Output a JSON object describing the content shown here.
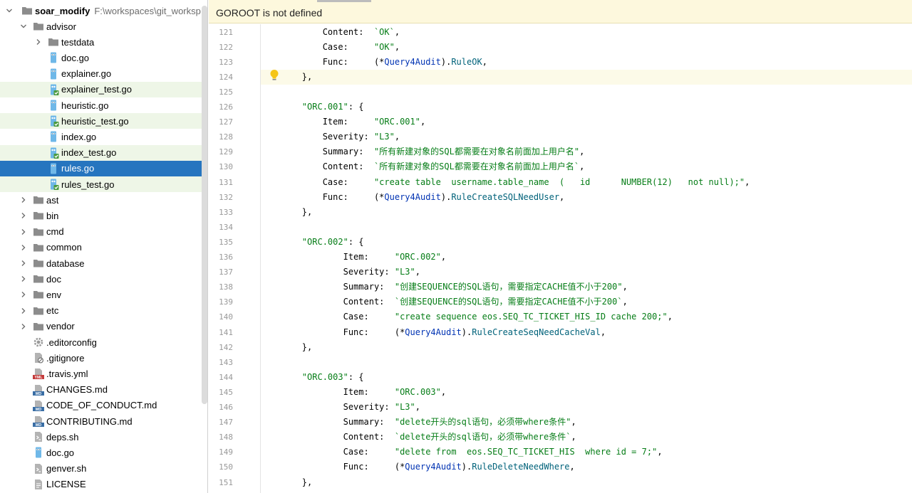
{
  "tree": {
    "root": {
      "name": "soar_modify",
      "path": "F:\\workspaces\\git_worksp"
    },
    "items": [
      {
        "label": "advisor",
        "type": "folder",
        "depth": 1,
        "expanded": true,
        "icon": "folder-icon"
      },
      {
        "label": "testdata",
        "type": "folder",
        "depth": 2,
        "expanded": false,
        "icon": "folder-icon"
      },
      {
        "label": "doc.go",
        "type": "file",
        "depth": 2,
        "icon": "go-file-icon"
      },
      {
        "label": "explainer.go",
        "type": "file",
        "depth": 2,
        "icon": "go-file-icon"
      },
      {
        "label": "explainer_test.go",
        "type": "file",
        "depth": 2,
        "icon": "go-test-file-icon",
        "tested": true
      },
      {
        "label": "heuristic.go",
        "type": "file",
        "depth": 2,
        "icon": "go-file-icon"
      },
      {
        "label": "heuristic_test.go",
        "type": "file",
        "depth": 2,
        "icon": "go-test-file-icon",
        "tested": true
      },
      {
        "label": "index.go",
        "type": "file",
        "depth": 2,
        "icon": "go-file-icon"
      },
      {
        "label": "index_test.go",
        "type": "file",
        "depth": 2,
        "icon": "go-test-file-icon",
        "tested": true
      },
      {
        "label": "rules.go",
        "type": "file",
        "depth": 2,
        "icon": "go-file-icon",
        "selected": true
      },
      {
        "label": "rules_test.go",
        "type": "file",
        "depth": 2,
        "icon": "go-test-file-icon",
        "tested": true
      },
      {
        "label": "ast",
        "type": "folder",
        "depth": 1,
        "expanded": false,
        "icon": "folder-icon"
      },
      {
        "label": "bin",
        "type": "folder",
        "depth": 1,
        "expanded": false,
        "icon": "folder-icon"
      },
      {
        "label": "cmd",
        "type": "folder",
        "depth": 1,
        "expanded": false,
        "icon": "folder-icon"
      },
      {
        "label": "common",
        "type": "folder",
        "depth": 1,
        "expanded": false,
        "icon": "folder-icon"
      },
      {
        "label": "database",
        "type": "folder",
        "depth": 1,
        "expanded": false,
        "icon": "folder-icon"
      },
      {
        "label": "doc",
        "type": "folder",
        "depth": 1,
        "expanded": false,
        "icon": "folder-icon"
      },
      {
        "label": "env",
        "type": "folder",
        "depth": 1,
        "expanded": false,
        "icon": "folder-icon"
      },
      {
        "label": "etc",
        "type": "folder",
        "depth": 1,
        "expanded": false,
        "icon": "folder-icon"
      },
      {
        "label": "vendor",
        "type": "folder",
        "depth": 1,
        "expanded": false,
        "icon": "folder-icon"
      },
      {
        "label": ".editorconfig",
        "type": "file",
        "depth": 1,
        "icon": "gear-icon"
      },
      {
        "label": ".gitignore",
        "type": "file",
        "depth": 1,
        "icon": "ignore-file-icon"
      },
      {
        "label": ".travis.yml",
        "type": "file",
        "depth": 1,
        "icon": "yaml-file-icon"
      },
      {
        "label": "CHANGES.md",
        "type": "file",
        "depth": 1,
        "icon": "markdown-file-icon"
      },
      {
        "label": "CODE_OF_CONDUCT.md",
        "type": "file",
        "depth": 1,
        "icon": "markdown-file-icon"
      },
      {
        "label": "CONTRIBUTING.md",
        "type": "file",
        "depth": 1,
        "icon": "markdown-file-icon"
      },
      {
        "label": "deps.sh",
        "type": "file",
        "depth": 1,
        "icon": "shell-file-icon"
      },
      {
        "label": "doc.go",
        "type": "file",
        "depth": 1,
        "icon": "go-file-icon"
      },
      {
        "label": "genver.sh",
        "type": "file",
        "depth": 1,
        "icon": "shell-file-icon"
      },
      {
        "label": "LICENSE",
        "type": "file",
        "depth": 1,
        "icon": "text-file-icon"
      }
    ]
  },
  "editor": {
    "notice": "GOROOT is not defined",
    "current_line": 124,
    "lines": [
      {
        "n": 121,
        "tokens": [
          [
            "p",
            "            Content:  "
          ],
          [
            "s",
            "`OK`"
          ],
          [
            "p",
            ","
          ]
        ]
      },
      {
        "n": 122,
        "tokens": [
          [
            "p",
            "            Case:     "
          ],
          [
            "s",
            "\"OK\""
          ],
          [
            "p",
            ","
          ]
        ]
      },
      {
        "n": 123,
        "tokens": [
          [
            "p",
            "            Func:     (*"
          ],
          [
            "t",
            "Query4Audit"
          ],
          [
            "p",
            ")."
          ],
          [
            "f",
            "RuleOK"
          ],
          [
            "p",
            ","
          ]
        ]
      },
      {
        "n": 124,
        "tokens": [
          [
            "p",
            "        },"
          ]
        ]
      },
      {
        "n": 125,
        "tokens": []
      },
      {
        "n": 126,
        "tokens": [
          [
            "p",
            "        "
          ],
          [
            "s",
            "\"ORC.001\""
          ],
          [
            "p",
            ": {"
          ]
        ]
      },
      {
        "n": 127,
        "tokens": [
          [
            "p",
            "            Item:     "
          ],
          [
            "s",
            "\"ORC.001\""
          ],
          [
            "p",
            ","
          ]
        ]
      },
      {
        "n": 128,
        "tokens": [
          [
            "p",
            "            Severity: "
          ],
          [
            "s",
            "\"L3\""
          ],
          [
            "p",
            ","
          ]
        ]
      },
      {
        "n": 129,
        "tokens": [
          [
            "p",
            "            Summary:  "
          ],
          [
            "s",
            "\"所有新建对象的SQL都需要在对象名前面加上用户名\""
          ],
          [
            "p",
            ","
          ]
        ]
      },
      {
        "n": 130,
        "tokens": [
          [
            "p",
            "            Content:  "
          ],
          [
            "s",
            "`所有新建对象的SQL都需要在对象名前面加上用户名`"
          ],
          [
            "p",
            ","
          ]
        ]
      },
      {
        "n": 131,
        "tokens": [
          [
            "p",
            "            Case:     "
          ],
          [
            "s",
            "\"create table  username.table_name  (   id      NUMBER(12)   not null);\""
          ],
          [
            "p",
            ","
          ]
        ]
      },
      {
        "n": 132,
        "tokens": [
          [
            "p",
            "            Func:     (*"
          ],
          [
            "t",
            "Query4Audit"
          ],
          [
            "p",
            ")."
          ],
          [
            "f",
            "RuleCreateSQLNeedUser"
          ],
          [
            "p",
            ","
          ]
        ]
      },
      {
        "n": 133,
        "tokens": [
          [
            "p",
            "        },"
          ]
        ]
      },
      {
        "n": 134,
        "tokens": []
      },
      {
        "n": 135,
        "tokens": [
          [
            "p",
            "        "
          ],
          [
            "s",
            "\"ORC.002\""
          ],
          [
            "p",
            ": {"
          ]
        ]
      },
      {
        "n": 136,
        "tokens": [
          [
            "p",
            "                Item:     "
          ],
          [
            "s",
            "\"ORC.002\""
          ],
          [
            "p",
            ","
          ]
        ]
      },
      {
        "n": 137,
        "tokens": [
          [
            "p",
            "                Severity: "
          ],
          [
            "s",
            "\"L3\""
          ],
          [
            "p",
            ","
          ]
        ]
      },
      {
        "n": 138,
        "tokens": [
          [
            "p",
            "                Summary:  "
          ],
          [
            "s",
            "\"创建SEQUENCE的SQL语句，需要指定CACHE值不小于200\""
          ],
          [
            "p",
            ","
          ]
        ]
      },
      {
        "n": 139,
        "tokens": [
          [
            "p",
            "                Content:  "
          ],
          [
            "s",
            "`创建SEQUENCE的SQL语句，需要指定CACHE值不小于200`"
          ],
          [
            "p",
            ","
          ]
        ]
      },
      {
        "n": 140,
        "tokens": [
          [
            "p",
            "                Case:     "
          ],
          [
            "s",
            "\"create sequence eos.SEQ_TC_TICKET_HIS_ID cache 200;\""
          ],
          [
            "p",
            ","
          ]
        ]
      },
      {
        "n": 141,
        "tokens": [
          [
            "p",
            "                Func:     (*"
          ],
          [
            "t",
            "Query4Audit"
          ],
          [
            "p",
            ")."
          ],
          [
            "f",
            "RuleCreateSeqNeedCacheVal"
          ],
          [
            "p",
            ","
          ]
        ]
      },
      {
        "n": 142,
        "tokens": [
          [
            "p",
            "        },"
          ]
        ]
      },
      {
        "n": 143,
        "tokens": []
      },
      {
        "n": 144,
        "tokens": [
          [
            "p",
            "        "
          ],
          [
            "s",
            "\"ORC.003\""
          ],
          [
            "p",
            ": {"
          ]
        ]
      },
      {
        "n": 145,
        "tokens": [
          [
            "p",
            "                Item:     "
          ],
          [
            "s",
            "\"ORC.003\""
          ],
          [
            "p",
            ","
          ]
        ]
      },
      {
        "n": 146,
        "tokens": [
          [
            "p",
            "                Severity: "
          ],
          [
            "s",
            "\"L3\""
          ],
          [
            "p",
            ","
          ]
        ]
      },
      {
        "n": 147,
        "tokens": [
          [
            "p",
            "                Summary:  "
          ],
          [
            "s",
            "\"delete开头的sql语句，必须带where条件\""
          ],
          [
            "p",
            ","
          ]
        ]
      },
      {
        "n": 148,
        "tokens": [
          [
            "p",
            "                Content:  "
          ],
          [
            "s",
            "`delete开头的sql语句，必须带where条件`"
          ],
          [
            "p",
            ","
          ]
        ]
      },
      {
        "n": 149,
        "tokens": [
          [
            "p",
            "                Case:     "
          ],
          [
            "s",
            "\"delete from  eos.SEQ_TC_TICKET_HIS  where id = 7;\""
          ],
          [
            "p",
            ","
          ]
        ]
      },
      {
        "n": 150,
        "tokens": [
          [
            "p",
            "                Func:     (*"
          ],
          [
            "t",
            "Query4Audit"
          ],
          [
            "p",
            ")."
          ],
          [
            "f",
            "RuleDeleteNeedWhere"
          ],
          [
            "p",
            ","
          ]
        ]
      },
      {
        "n": 151,
        "tokens": [
          [
            "p",
            "        },"
          ]
        ]
      }
    ]
  },
  "colors": {
    "selection": "#2675bf",
    "tested_bg": "#eef6e7",
    "notice_bg": "#fdf8dd",
    "string": "#067d17",
    "function": "#00627a",
    "type": "#0033b3"
  }
}
